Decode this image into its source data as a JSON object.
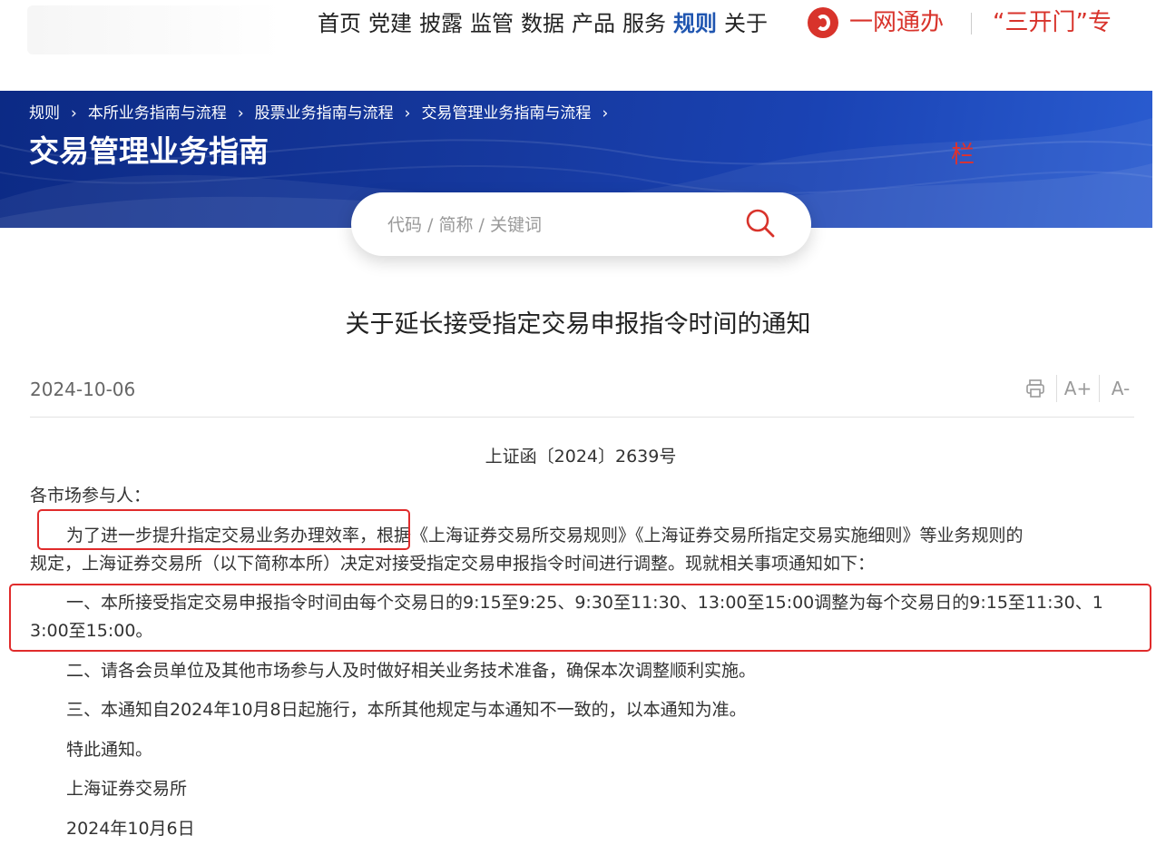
{
  "nav": {
    "items": [
      "首页",
      "党建",
      "披露",
      "监管",
      "数据",
      "产品",
      "服务",
      "规则",
      "关于"
    ],
    "active": "规则",
    "yiwang": "一网通办",
    "sankaimen": "“三开门”专"
  },
  "banner": {
    "breadcrumb": [
      "规则",
      "本所业务指南与流程",
      "股票业务指南与流程",
      "交易管理业务指南与流程"
    ],
    "title": "交易管理业务指南",
    "mark": "栏"
  },
  "search": {
    "placeholder": "代码 / 简称 / 关键词"
  },
  "article": {
    "title": "关于延长接受指定交易申报指令时间的通知",
    "date": "2024-10-06",
    "tools": {
      "font_up": "A+",
      "font_down": "A-"
    },
    "doc_no": "上证函〔2024〕2639号",
    "salutation": "各市场参与人：",
    "p1_line1": "为了进一步提升指定交易业务办理效率，根据《上海证券交易所交易规则》《上海证券交易所指定交易实施细则》等业务规则的",
    "p1_line2": "规定，上海证券交易所（以下简称本所）决定对接受指定交易申报指令时间进行调整。现就相关事项通知如下：",
    "p2_line1": "一、本所接受指定交易申报指令时间由每个交易日的9:15至9:25、9:30至11:30、13:00至15:00调整为每个交易日的9:15至11:30、1",
    "p2_line2": "3:00至15:00。",
    "p3": "二、请各会员单位及其他市场参与人及时做好相关业务技术准备，确保本次调整顺利实施。",
    "p4": "三、本通知自2024年10月8日起施行，本所其他规定与本通知不一致的，以本通知为准。",
    "closing": "特此通知。",
    "signature": "上海证券交易所",
    "sign_date": "2024年10月6日"
  },
  "colors": {
    "brand_blue": "#1a43b4",
    "brand_red": "#d8332b",
    "highlight_box": "#e02b2b"
  }
}
